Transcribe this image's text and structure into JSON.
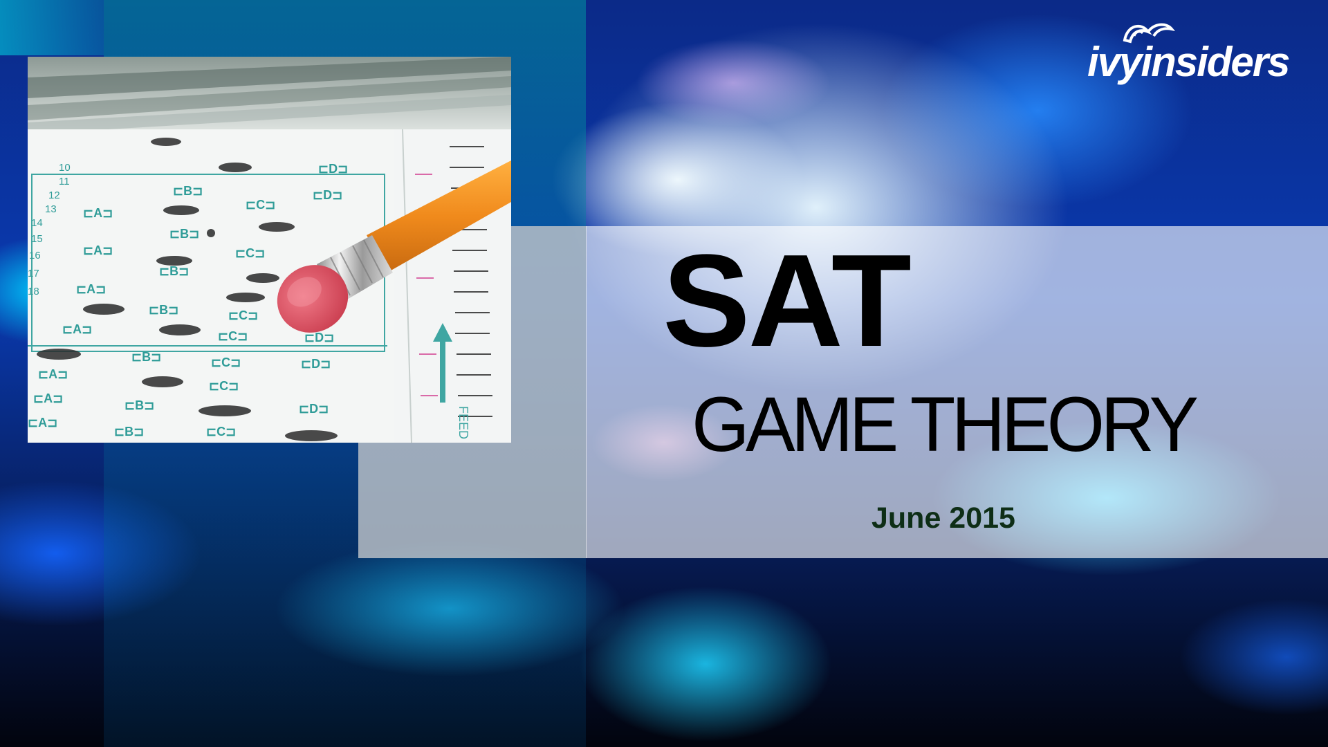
{
  "slide": {
    "title": "SAT",
    "subtitle": "GAME THEORY",
    "date": "June 2015"
  },
  "logo": {
    "text": "ivyinsiders",
    "color": "#ffffff"
  },
  "photo": {
    "question_numbers": [
      "10",
      "11",
      "12",
      "13",
      "14",
      "15",
      "16",
      "17",
      "18"
    ],
    "answer_letters": [
      "A",
      "B",
      "C",
      "D"
    ],
    "stamp_text": "FEED"
  },
  "colors": {
    "date_text": "#0e2e16",
    "title_text": "#000000",
    "pencil": "#f08a1c",
    "eraser": "#e4576a"
  }
}
